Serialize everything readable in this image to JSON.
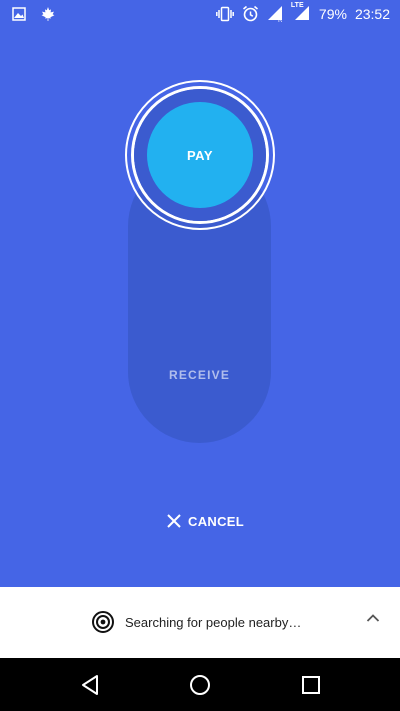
{
  "status_bar": {
    "battery": "79%",
    "time": "23:52",
    "network_label": "LTE",
    "icons_left": [
      "image-icon",
      "maple-leaf-icon"
    ],
    "icons_right": [
      "vibrate-icon",
      "alarm-icon",
      "signal-icon",
      "lte-signal-icon",
      "battery-icon"
    ]
  },
  "toggle": {
    "pay_label": "PAY",
    "receive_label": "RECEIVE"
  },
  "cancel": {
    "label": "CANCEL",
    "icon": "close-icon"
  },
  "bottom_sheet": {
    "status_text": "Searching for people nearby…",
    "icon": "target-icon",
    "expand_icon": "chevron-up-icon"
  },
  "nav_bar": {
    "buttons": [
      "back-icon",
      "home-icon",
      "recents-icon"
    ]
  },
  "colors": {
    "background": "#4565E6",
    "track": "#3B5BCF",
    "pay_button": "#22B1F0",
    "sheet": "#FFFFFF",
    "nav": "#000000"
  }
}
